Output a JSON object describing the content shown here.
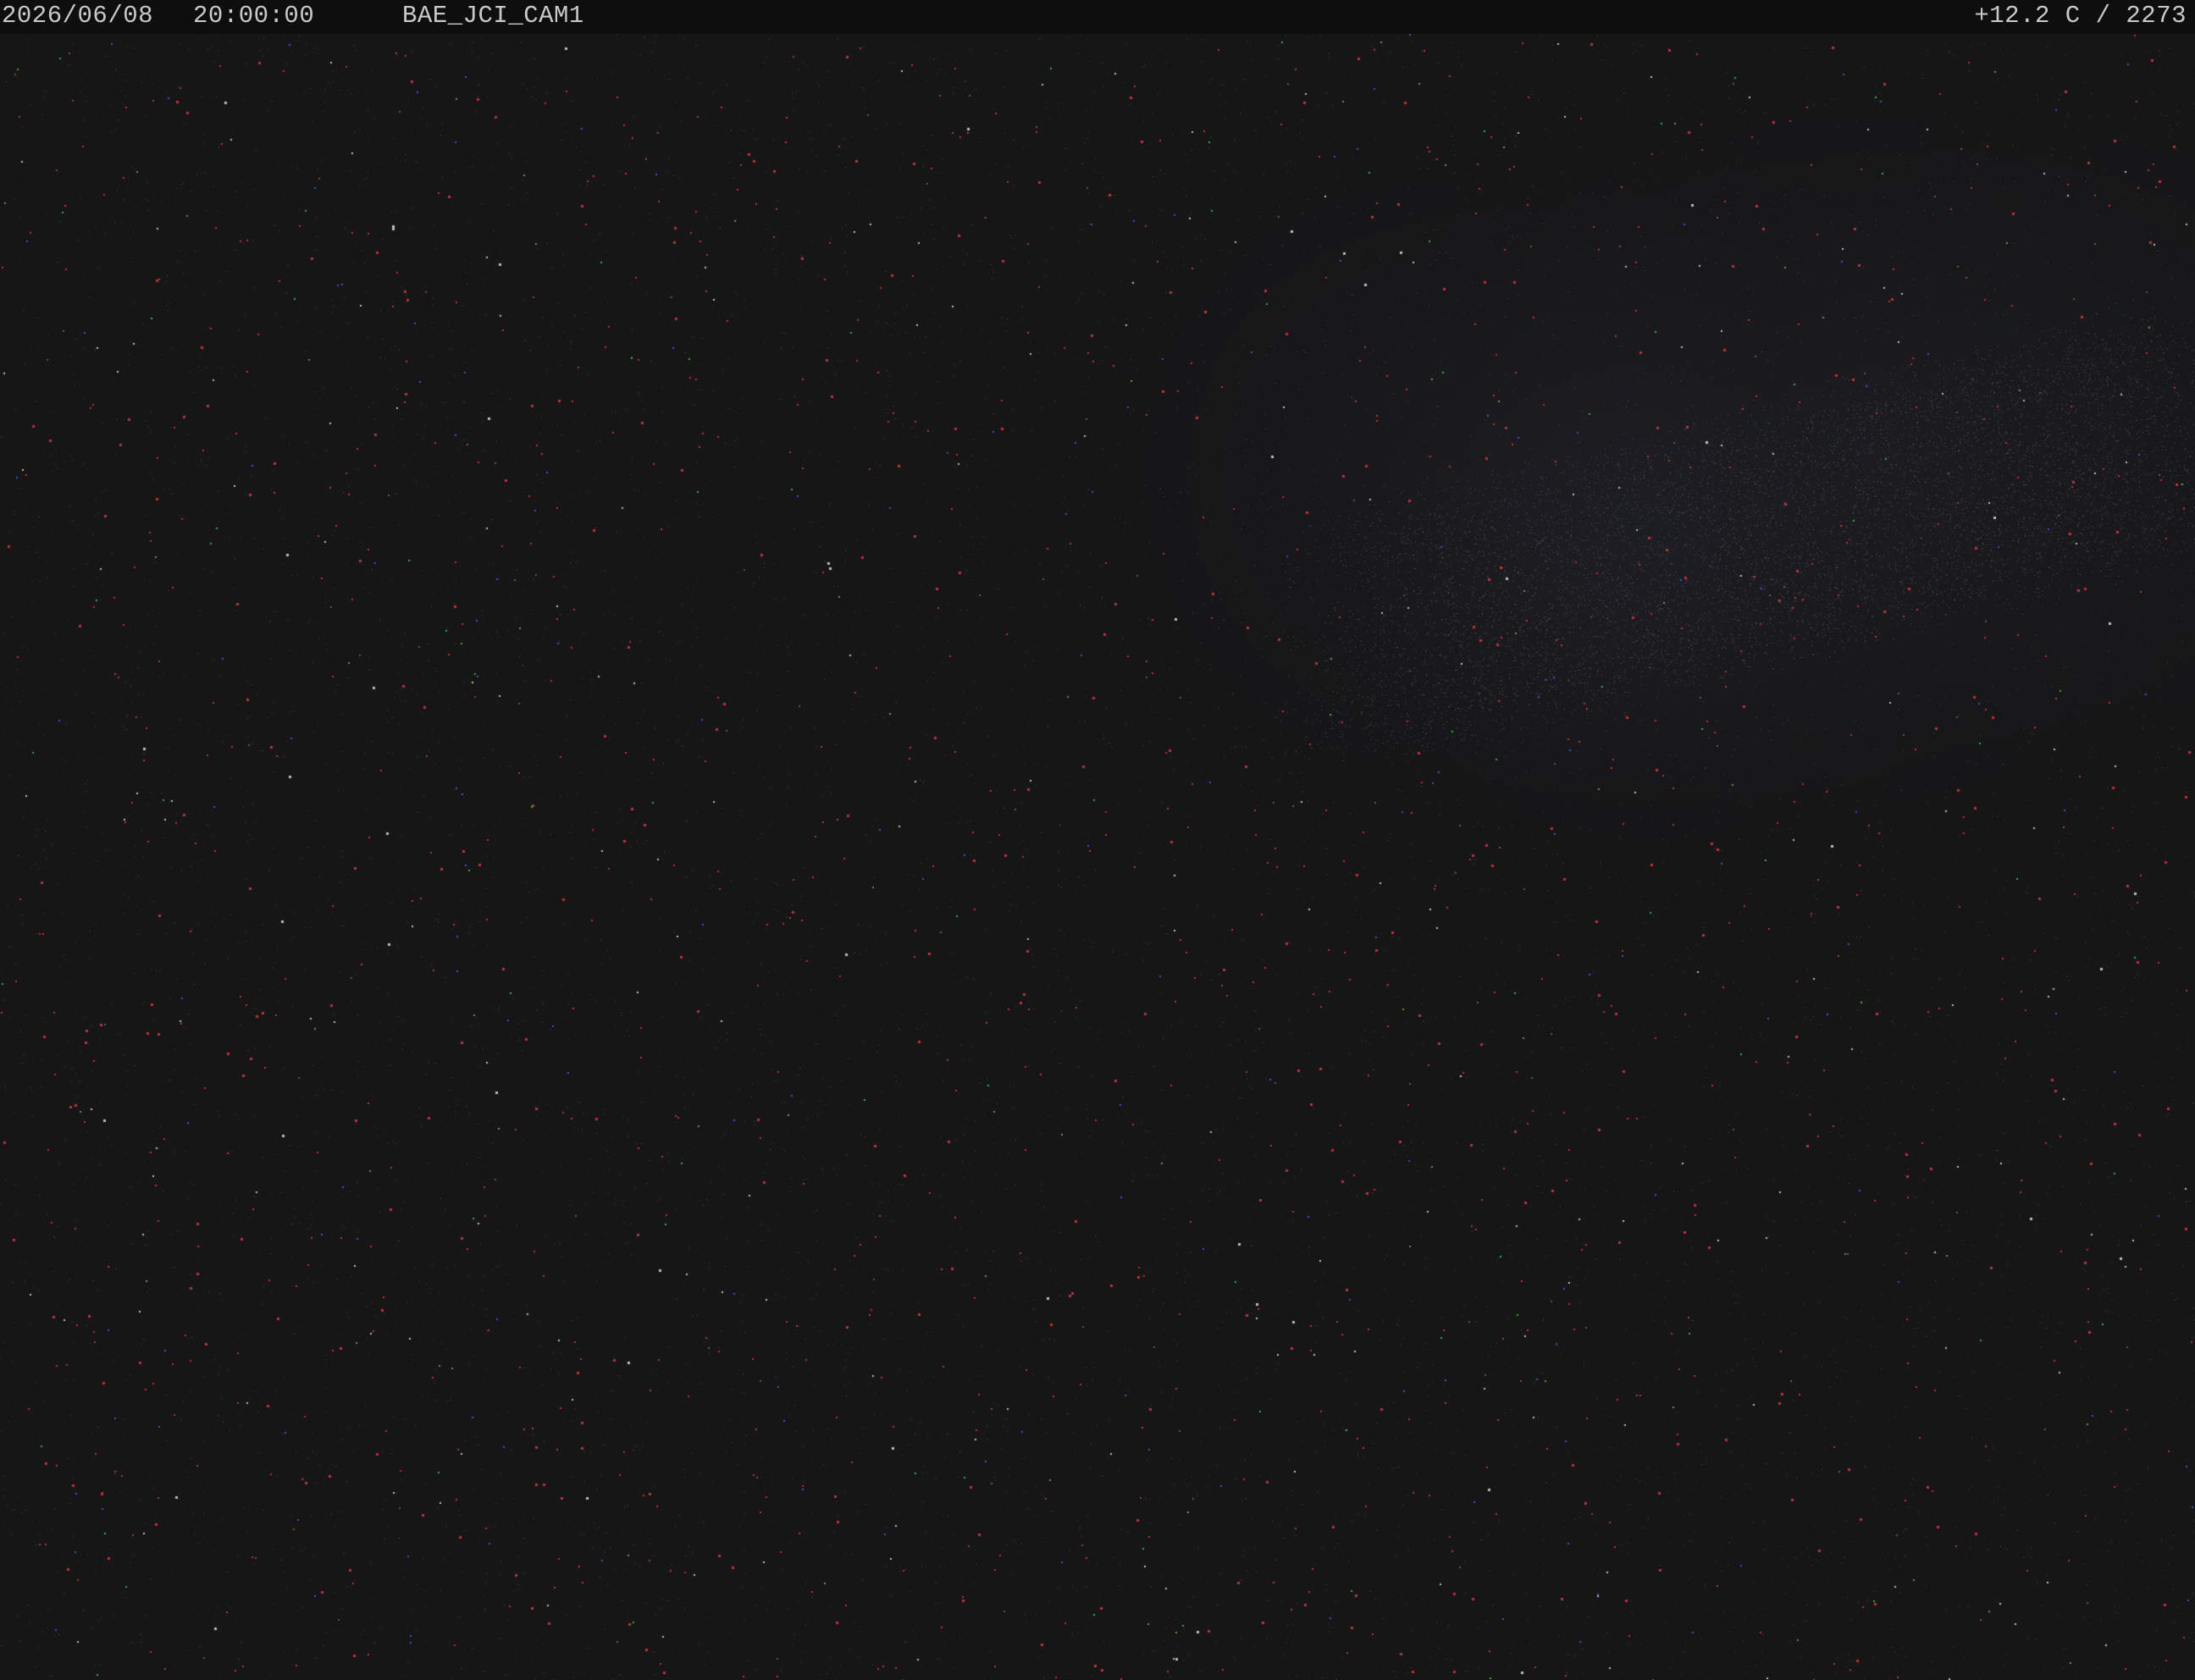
{
  "overlay": {
    "date": "2026/06/08",
    "time": "20:00:00",
    "camera_id": "BAE_JCI_CAM1",
    "status": "+12.2 C / 2273"
  },
  "colors": {
    "sky_background": "#161617",
    "header_background": "#0e0e0e",
    "header_text": "#c9c9c9",
    "star_red": "#c0303a",
    "star_blue": "#4550c8",
    "star_green": "#3fae4a",
    "star_white": "#bfbfbf",
    "milky_way_band": "#3a3f5a"
  },
  "image": {
    "subject": "night-sky-all-sky-camera-frame",
    "milky_way_visible": true
  }
}
